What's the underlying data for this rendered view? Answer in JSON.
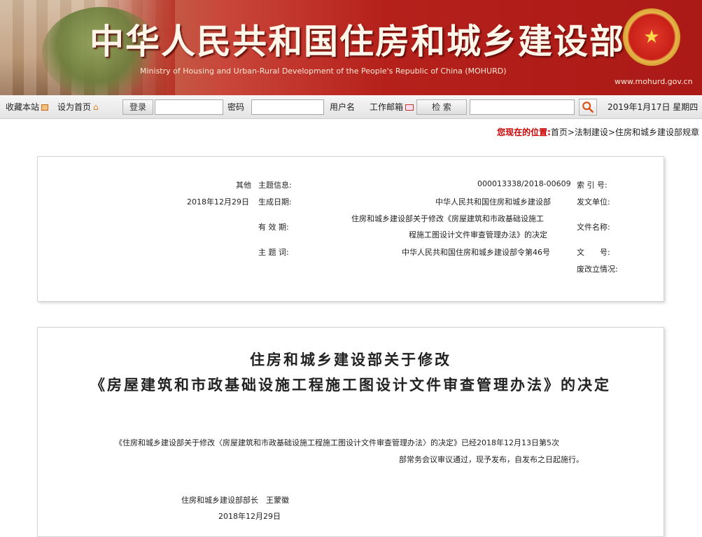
{
  "banner": {
    "title": "中华人民共和国住房和城乡建设部",
    "subtitle": "Ministry of Housing and Urban-Rural Development of the People's Republic of China (MOHURD)",
    "site": "www.mohurd.gov.cn"
  },
  "toolbar": {
    "date": "2019年1月17日 星期四",
    "search_button": "检 索",
    "email_link": "工作邮箱",
    "username_label": "用户名",
    "password_label": "密码",
    "login_button": "登录",
    "set_home": "设为首页",
    "add_favorite": "收藏本站",
    "search_value": "",
    "username_value": "",
    "password_value": ""
  },
  "breadcrumb": {
    "label": "您现在的位置:",
    "path": "首页>法制建设>住房和城乡建设部规章"
  },
  "info": {
    "index_label": "索 引 号:",
    "index_value": "000013338/2018-00609",
    "category_label": "主题信息:",
    "category_value": "其他",
    "issuer_label": "发文单位:",
    "issuer_value": "中华人民共和国住房和城乡建设部",
    "date_label": "生成日期:",
    "date_value": "2018年12月29日",
    "name_label": "文件名称:",
    "name_value_line1": "住房和城乡建设部关于修改《房屋建筑和市政基础设施工",
    "name_value_line2": "程施工图设计文件审查管理办法》的决定",
    "validity_label": "有 效 期:",
    "validity_value": "",
    "number_label": "文　　号:",
    "number_value": "中华人民共和国住房和城乡建设部令第46号",
    "topic_label": "主 题 词:",
    "topic_value": "",
    "abolish_label": "废改立情况:"
  },
  "document": {
    "title_line1": "住房和城乡建设部关于修改",
    "title_line2": "《房屋建筑和市政基础设施工程施工图设计文件审查管理办法》的决定",
    "body_line1": "《住房和城乡建设部关于修改〈房屋建筑和市政基础设施工程施工图设计文件审查管理办法〉的决定》已经2018年12月13日第5次",
    "body_line2": "部常务会议审议通过，现予发布，自发布之日起施行。",
    "signature": "住房和城乡建设部部长　王蒙徽",
    "sign_date": "2018年12月29日"
  }
}
